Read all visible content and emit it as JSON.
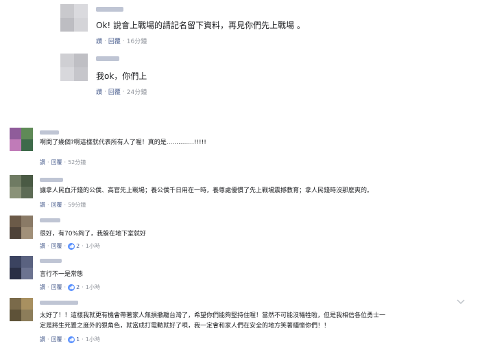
{
  "replies": [
    {
      "text": "Ok! 說會上戰場的請記名留下資料，再見你們先上戰場 。",
      "reply": "讚",
      "action": "回覆",
      "time": "16分鐘",
      "avatar_colors": [
        "#c9c9cd",
        "#dadade",
        "#bdbdc2",
        "#d4d4d8"
      ]
    },
    {
      "text": "我ok，你們上",
      "reply": "讚",
      "action": "回覆",
      "time": "24分鐘",
      "avatar_colors": [
        "#cfcfd3",
        "#bfbfc4",
        "#d8d8dc",
        "#c6c6cb"
      ]
    }
  ],
  "comments": [
    {
      "text": "啊問了幾個?啊這樣就代表所有人了喔！真的是..............!!!!!",
      "reply": "讚",
      "action": "回覆",
      "time": "52分鐘",
      "avatar_colors": [
        "#8f5c9a",
        "#5f8a57",
        "#c07bb8",
        "#3e6a4a"
      ]
    },
    {
      "text": "讓拿人民血汗錢的公僕、高官先上戰場；養公僕千日用在一時，養尊處優慣了先上戰場震撼教育；拿人民錢時沒那麼爽的。",
      "reply": "讚",
      "action": "回覆",
      "time": "59分鐘",
      "avatar_colors": [
        "#6f7b63",
        "#4a5a44",
        "#8a9278",
        "#5d6b55"
      ]
    },
    {
      "text": "很好，有70%夠了，我躲在地下室就好",
      "reply": "讚",
      "action": "回覆",
      "likes": "2",
      "time": "1小時",
      "avatar_colors": [
        "#6b5a48",
        "#8a7a66",
        "#4e4238",
        "#a19079"
      ]
    },
    {
      "text": "言行不一是常態",
      "reply": "讚",
      "action": "回覆",
      "likes": "2",
      "time": "1小時",
      "avatar_colors": [
        "#3b4360",
        "#5a6280",
        "#2a2f45",
        "#6c7390"
      ]
    },
    {
      "text_line1": "太好了！！這樣我就更有機會帶著家人無損撤離台灣了，希望你們能夠堅持住喔！當然不可能沒犧牲啦，但是我相信各位勇士一",
      "text_line2": "定是將生死置之度外的狠角色，就當成打電動就好了唄，我一定會和家人們在安全的地方笑著緬懷你們！！",
      "reply": "讚",
      "action": "回覆",
      "likes": "1",
      "time": "1小時",
      "avatar_colors": [
        "#7a6a4a",
        "#a89060",
        "#5e5238",
        "#8c7d5a"
      ]
    }
  ],
  "colors": {
    "link": "#4b5f8f",
    "meta": "#90949c",
    "like_badge": "#5890ff",
    "text": "#1c1e21"
  },
  "icons": [
    "thumbs-up-icon",
    "chevron-down-icon"
  ]
}
